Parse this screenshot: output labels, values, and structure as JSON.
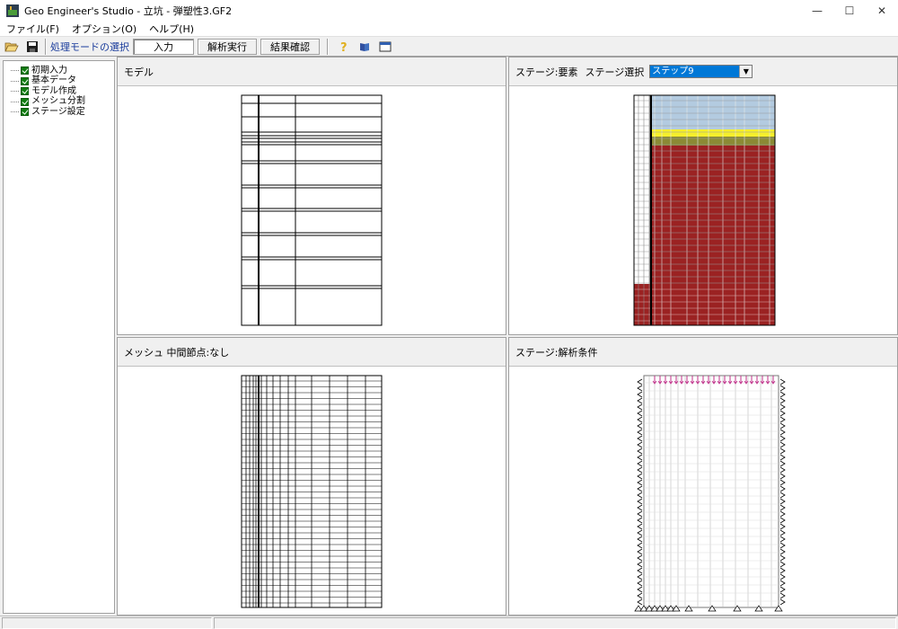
{
  "window": {
    "title": "Geo Engineer's Studio - 立坑 - 弾塑性3.GF2"
  },
  "menu": [
    "ファイル(F)",
    "オプション(O)",
    "ヘルプ(H)"
  ],
  "toolbar": {
    "mode_label": "処理モードの選択",
    "modes": [
      "入力",
      "解析実行",
      "結果確認"
    ],
    "active_mode": "入力"
  },
  "tree": {
    "items": [
      "初期入力",
      "基本データ",
      "モデル作成",
      "メッシュ分割",
      "ステージ設定"
    ]
  },
  "panels": {
    "model": {
      "title": "モデル"
    },
    "stage_element": {
      "title": "ステージ:要素",
      "select_label": "ステージ選択",
      "select_value": "ステップ9"
    },
    "mesh": {
      "title": "メッシュ 中間節点:なし"
    },
    "stage_condition": {
      "title": "ステージ:解析条件"
    }
  },
  "colors": {
    "sky": "#b3cbe0",
    "yellow": "#f5ef2c",
    "olive": "#8b8a35",
    "soil": "#9b2222",
    "accent": "#0078d7",
    "load": "#c0308a"
  },
  "icons": [
    "open-folder-icon",
    "save-icon",
    "help-icon",
    "book-icon",
    "window-icon",
    "minimize-icon",
    "maximize-icon",
    "close-icon",
    "app-icon",
    "checkbox-icon",
    "dropdown-arrow-icon"
  ]
}
